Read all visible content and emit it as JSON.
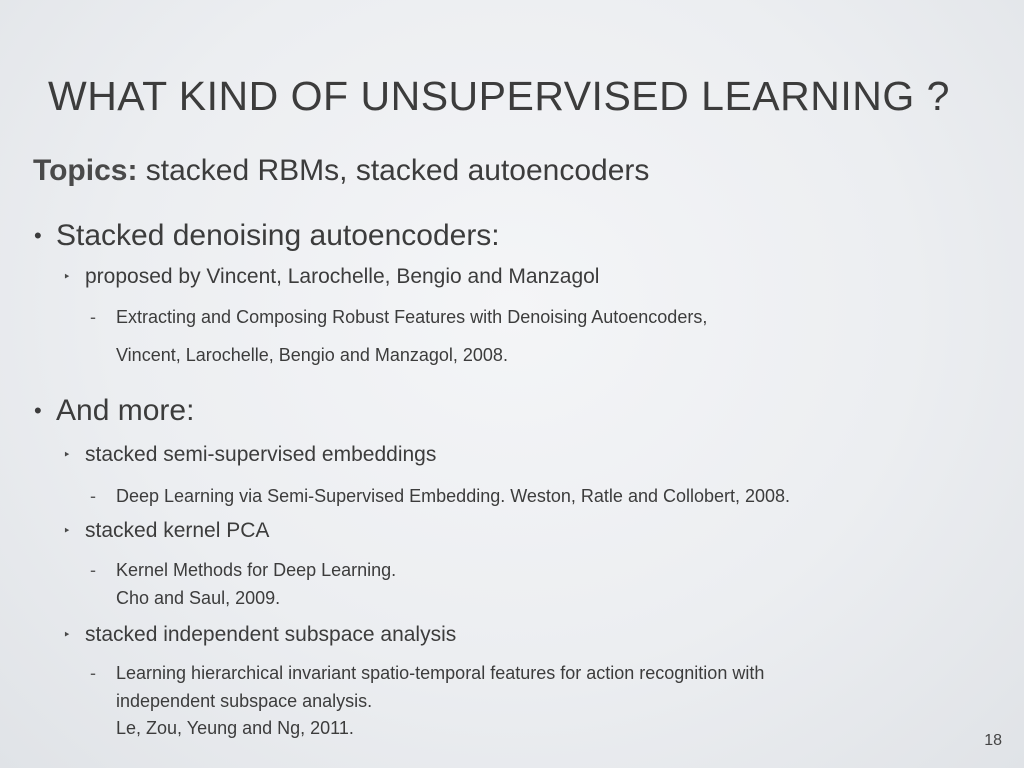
{
  "slide": {
    "title": "WHAT KIND OF UNSUPERVISED LEARNING ?",
    "topics_label": "Topics:",
    "topics_text": " stacked RBMs, stacked autoencoders",
    "bullet_char": "•",
    "sub_bullet_char": "‣",
    "dash_char": "-",
    "sections": [
      {
        "heading": "Stacked denoising autoencoders:",
        "items": [
          {
            "text": "proposed by Vincent, Larochelle, Bengio and Manzagol",
            "refs": [
              "Extracting and Composing Robust Features with Denoising Autoencoders,",
              "Vincent, Larochelle, Bengio and Manzagol,  2008."
            ]
          }
        ]
      },
      {
        "heading": "And more:",
        "items": [
          {
            "text": "stacked semi-supervised embeddings",
            "refs": [
              "Deep Learning via Semi-Supervised Embedding. Weston, Ratle and Collobert, 2008."
            ]
          },
          {
            "text": "stacked kernel PCA",
            "refs": [
              "Kernel Methods for Deep Learning.",
              "Cho and Saul, 2009."
            ]
          },
          {
            "text": "stacked independent subspace analysis",
            "refs": [
              "Learning hierarchical invariant spatio-temporal features for action recognition with",
              "independent subspace analysis.",
              "Le, Zou, Yeung and Ng, 2011."
            ]
          }
        ]
      }
    ],
    "page_number": "18"
  }
}
